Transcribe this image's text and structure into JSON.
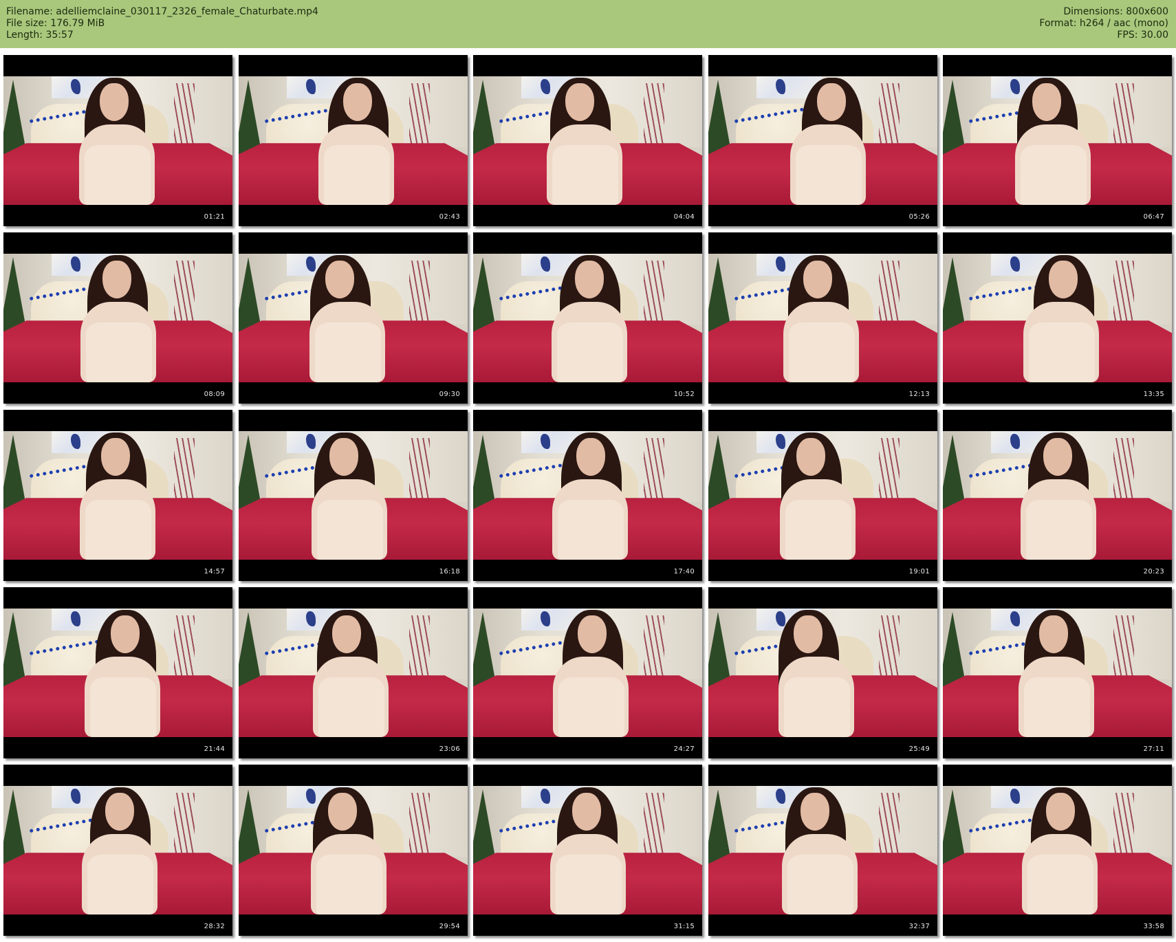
{
  "header": {
    "filename_line": "Filename: adelliemclaine_030117_2326_female_Chaturbate.mp4",
    "filesize_line": "File size: 176.79 MiB",
    "length_line": "Length: 35:57",
    "dimensions_line": "Dimensions: 800x600",
    "format_line": "Format: h264 / aac (mono)",
    "fps_line": "FPS: 30.00"
  },
  "colors": {
    "header_background": "#a9c87c",
    "page_background": "#ffffff",
    "bed": "#c42a48"
  },
  "thumbnails": [
    {
      "time": "01:21"
    },
    {
      "time": "02:43"
    },
    {
      "time": "04:04"
    },
    {
      "time": "05:26"
    },
    {
      "time": "06:47"
    },
    {
      "time": "08:09"
    },
    {
      "time": "09:30"
    },
    {
      "time": "10:52"
    },
    {
      "time": "12:13"
    },
    {
      "time": "13:35"
    },
    {
      "time": "14:57"
    },
    {
      "time": "16:18"
    },
    {
      "time": "17:40"
    },
    {
      "time": "19:01"
    },
    {
      "time": "20:23"
    },
    {
      "time": "21:44"
    },
    {
      "time": "23:06"
    },
    {
      "time": "24:27"
    },
    {
      "time": "25:49"
    },
    {
      "time": "27:11"
    },
    {
      "time": "28:32"
    },
    {
      "time": "29:54"
    },
    {
      "time": "31:15"
    },
    {
      "time": "32:37"
    },
    {
      "time": "33:58"
    }
  ]
}
